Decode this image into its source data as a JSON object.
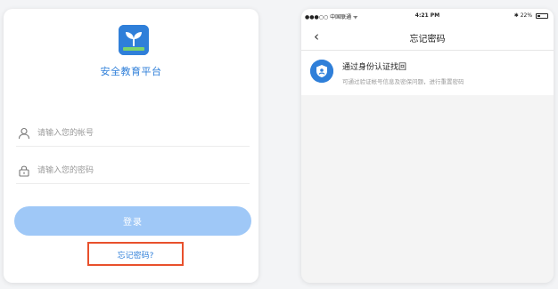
{
  "login": {
    "app_name": "安全教育平台",
    "username_placeholder": "请输入您的帐号",
    "password_placeholder": "请输入您的密码",
    "login_label": "登录",
    "forgot_label": "忘记密码?"
  },
  "phone": {
    "carrier": "●●●○○ 中国联通 ᯤ",
    "time": "4:21 PM",
    "battery": "✱ 22%"
  },
  "forgot_page": {
    "back_glyph": "‹",
    "title": "忘记密码",
    "option_title": "通过身份认证找回",
    "option_desc": "可通过验证帐号信息及密保问题，进行重置密码"
  },
  "colors": {
    "brand_blue": "#2f7fd9",
    "login_button": "#9fc8f7",
    "highlight_border": "#e8502c",
    "leaf_green": "#7bd36b"
  },
  "icons": [
    "app-logo-icon",
    "user-icon",
    "lock-icon",
    "back-chevron-icon",
    "shield-icon",
    "battery-icon"
  ]
}
